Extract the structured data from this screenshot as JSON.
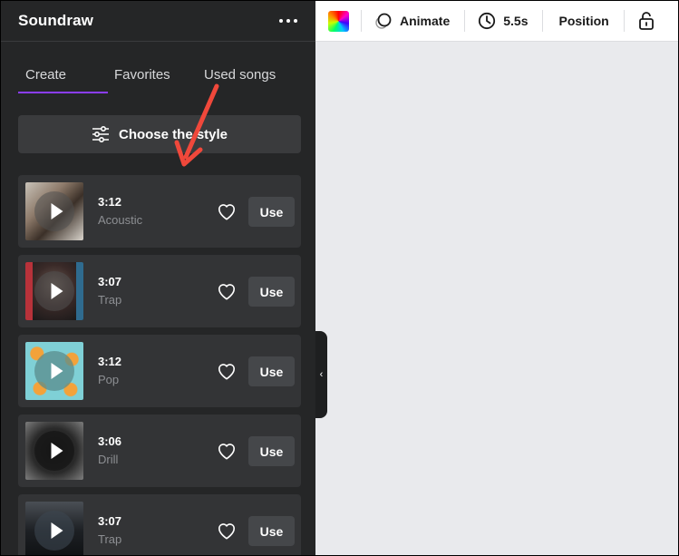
{
  "panel": {
    "title": "Soundraw",
    "tabs": [
      "Create",
      "Favorites",
      "Used songs"
    ],
    "style_button": "Choose the style"
  },
  "songs": [
    {
      "duration": "3:12",
      "genre": "Acoustic",
      "use": "Use"
    },
    {
      "duration": "3:07",
      "genre": "Trap",
      "use": "Use"
    },
    {
      "duration": "3:12",
      "genre": "Pop",
      "use": "Use"
    },
    {
      "duration": "3:06",
      "genre": "Drill",
      "use": "Use"
    },
    {
      "duration": "3:07",
      "genre": "Trap",
      "use": "Use"
    }
  ],
  "toolbar": {
    "animate": "Animate",
    "duration": "5.5s",
    "position": "Position"
  },
  "colors": {
    "panel_bg": "#252627",
    "card_bg": "#333436",
    "accent_underline": "#8b3dff",
    "annotation_arrow": "#f0483b"
  }
}
